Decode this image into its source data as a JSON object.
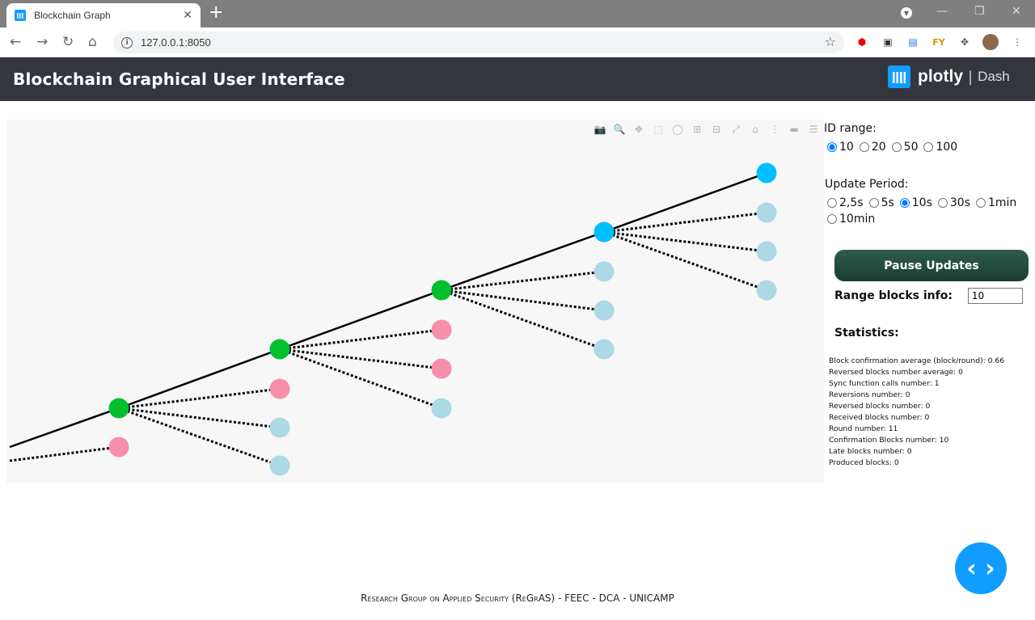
{
  "browser": {
    "tab_title": "Blockchain Graph",
    "tab_close": "✕",
    "new_tab": "+",
    "url": "127.0.0.1:8050",
    "info_icon": "i"
  },
  "header": {
    "title": "Blockchain Graphical User Interface",
    "logo_word": "plotly",
    "logo_sep": "|",
    "logo_dash": "Dash"
  },
  "controls": {
    "id_range_label": "ID range:",
    "id_range_options": [
      "10",
      "20",
      "50",
      "100"
    ],
    "id_range_selected": "10",
    "update_period_label": "Update Period:",
    "update_period_options": [
      "2,5s",
      "5s",
      "10s",
      "30s",
      "1min",
      "10min"
    ],
    "update_period_selected": "10s",
    "pause_label": "Pause Updates",
    "range_blocks_label": "Range blocks info:",
    "range_blocks_value": "10"
  },
  "statistics": {
    "title": "Statistics:",
    "items": [
      "Block confirmation average (block/round): 0.66",
      "Reversed blocks number average: 0",
      "Sync function calls number: 1",
      "Reversions number: 0",
      "Reversed blocks number: 0",
      "Received blocks number: 0",
      "Round number: 11",
      "Confirmation Blocks number: 10",
      "Late blocks number: 0",
      "Produced blocks: 0"
    ]
  },
  "footer": {
    "text": "Research Group on Applied Security (ReGrAS) - FEEC - DCA - UNICAMP"
  },
  "colors": {
    "confirmed": "#00c030",
    "head": "#00bfff",
    "reversed": "#f78fab",
    "pending": "#add8e6"
  },
  "chart_data": {
    "type": "scatter",
    "description_nodes": [
      {
        "id": "c0",
        "status": "confirmed"
      },
      {
        "id": "c1",
        "status": "confirmed"
      },
      {
        "id": "c2",
        "status": "confirmed"
      },
      {
        "id": "c3",
        "status": "head"
      },
      {
        "id": "c4",
        "status": "head"
      }
    ]
  }
}
